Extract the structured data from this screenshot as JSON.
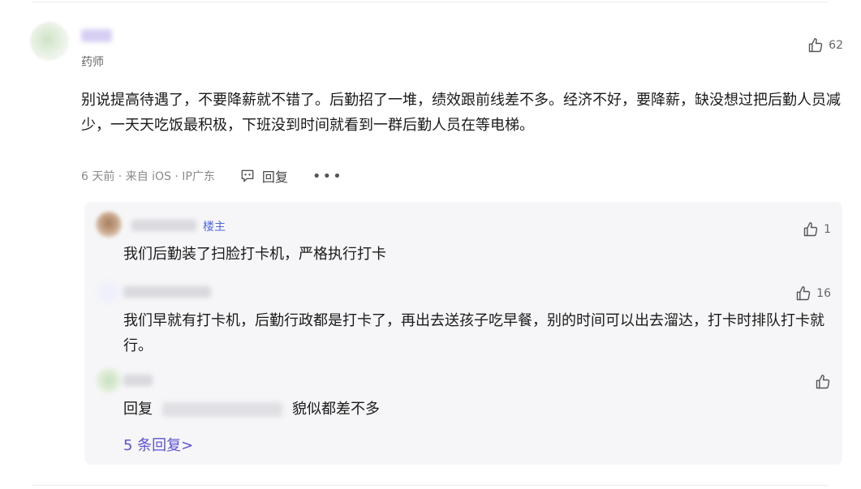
{
  "comment": {
    "role": "药师",
    "likes": "62",
    "text": "别说提高待遇了，不要降薪就不错了。后勤招了一堆，绩效跟前线差不多。经济不好，要降薪，缺没想过把后勤人员减少，一天天吃饭最积极，下班没到时间就看到一群后勤人员在等电梯。",
    "meta": "6 天前 · 来自 iOS · IP广东",
    "reply_label": "回复",
    "more_label": "•••"
  },
  "replies": [
    {
      "tag": "楼主",
      "likes": "1",
      "text": "我们后勤装了扫脸打卡机，严格执行打卡"
    },
    {
      "likes": "16",
      "text": "我们早就有打卡机，后勤行政都是打卡了，再出去送孩子吃早餐，别的时间可以出去溜达，打卡时排队打卡就行。"
    },
    {
      "prefix": "回复",
      "text": "貌似都差不多"
    }
  ],
  "more_replies": "5 条回复>",
  "icons": {
    "like": "thumbs-up-icon",
    "comment": "comment-bubble-icon",
    "more": "ellipsis-icon"
  }
}
